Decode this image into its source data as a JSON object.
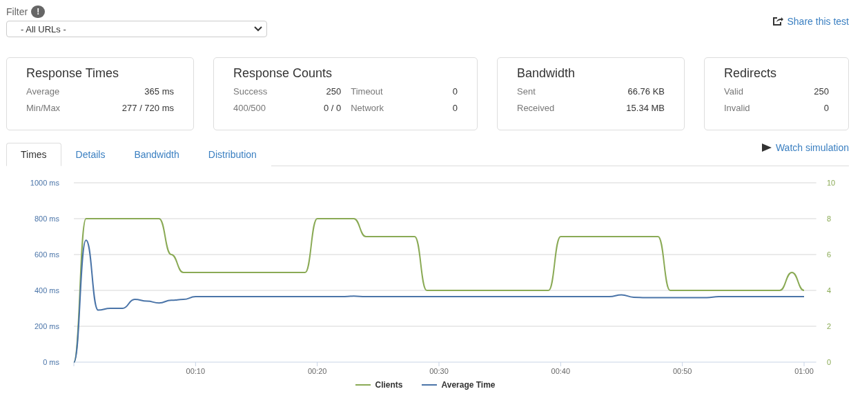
{
  "filter": {
    "label": "Filter",
    "info": "!",
    "select": {
      "value": "- All URLs -"
    }
  },
  "share_link": "Share this test",
  "cards": [
    {
      "title": "Response Times",
      "rows": [
        [
          {
            "label": "Average",
            "value": "365 ms"
          }
        ],
        [
          {
            "label": "Min/Max",
            "value": "277 / 720 ms"
          }
        ]
      ]
    },
    {
      "title": "Response Counts",
      "rows": [
        [
          {
            "label": "Success",
            "value": "250"
          },
          {
            "label": "Timeout",
            "value": "0"
          }
        ],
        [
          {
            "label": "400/500",
            "value": "0 / 0"
          },
          {
            "label": "Network",
            "value": "0"
          }
        ]
      ]
    },
    {
      "title": "Bandwidth",
      "rows": [
        [
          {
            "label": "Sent",
            "value": "66.76 KB"
          }
        ],
        [
          {
            "label": "Received",
            "value": "15.34 MB"
          }
        ]
      ]
    },
    {
      "title": "Redirects",
      "rows": [
        [
          {
            "label": "Valid",
            "value": "250"
          }
        ],
        [
          {
            "label": "Invalid",
            "value": "0"
          }
        ]
      ]
    }
  ],
  "tabs": [
    {
      "label": "Times",
      "selected": true
    },
    {
      "label": "Details",
      "selected": false
    },
    {
      "label": "Bandwidth",
      "selected": false
    },
    {
      "label": "Distribution",
      "selected": false
    }
  ],
  "watch_link": "Watch simulation",
  "chart_data": {
    "type": "line",
    "x": [
      0,
      1,
      2,
      3,
      4,
      5,
      6,
      7,
      8,
      9,
      10,
      11,
      12,
      13,
      14,
      15,
      16,
      17,
      18,
      19,
      20,
      21,
      22,
      23,
      24,
      25,
      26,
      27,
      28,
      29,
      30,
      31,
      32,
      33,
      34,
      35,
      36,
      37,
      38,
      39,
      40,
      41,
      42,
      43,
      44,
      45,
      46,
      47,
      48,
      49,
      50,
      51,
      52,
      53,
      54,
      55,
      56,
      57,
      58,
      59,
      60
    ],
    "xlim": [
      0,
      61
    ],
    "grid": true,
    "xticks": [
      {
        "value": 10,
        "label": "00:10"
      },
      {
        "value": 20,
        "label": "00:20"
      },
      {
        "value": 30,
        "label": "00:30"
      },
      {
        "value": 40,
        "label": "00:40"
      },
      {
        "value": 50,
        "label": "00:50"
      },
      {
        "value": 60,
        "label": "01:00"
      }
    ],
    "ylim": [
      0,
      1000
    ],
    "yticks": [
      {
        "value": 0,
        "label": "0 ms"
      },
      {
        "value": 200,
        "label": "200 ms"
      },
      {
        "value": 400,
        "label": "400 ms"
      },
      {
        "value": 600,
        "label": "600 ms"
      },
      {
        "value": 800,
        "label": "800 ms"
      },
      {
        "value": 1000,
        "label": "1000 ms"
      }
    ],
    "y2lim": [
      0,
      10
    ],
    "y2ticks": [
      0,
      2,
      4,
      6,
      8,
      10
    ],
    "series": [
      {
        "name": "Clients",
        "color": "#8aaa55",
        "axis": "y2",
        "values": [
          0,
          8,
          8,
          8,
          8,
          8,
          8,
          8,
          6,
          5,
          5,
          5,
          5,
          5,
          5,
          5,
          5,
          5,
          5,
          5,
          8,
          8,
          8,
          8,
          7,
          7,
          7,
          7,
          7,
          4,
          4,
          4,
          4,
          4,
          4,
          4,
          4,
          4,
          4,
          4,
          7,
          7,
          7,
          7,
          7,
          7,
          7,
          7,
          7,
          4,
          4,
          4,
          4,
          4,
          4,
          4,
          4,
          4,
          4,
          5,
          4
        ]
      },
      {
        "name": "Average Time",
        "color": "#4a74a8",
        "values": [
          0,
          680,
          290,
          300,
          300,
          350,
          340,
          330,
          345,
          350,
          365,
          365,
          365,
          365,
          365,
          365,
          365,
          365,
          365,
          365,
          365,
          365,
          365,
          368,
          365,
          365,
          365,
          365,
          365,
          365,
          365,
          365,
          365,
          365,
          365,
          365,
          365,
          365,
          365,
          365,
          365,
          365,
          365,
          365,
          365,
          375,
          362,
          360,
          360,
          360,
          360,
          360,
          360,
          365,
          365,
          365,
          365,
          365,
          365,
          365,
          365
        ]
      }
    ]
  }
}
